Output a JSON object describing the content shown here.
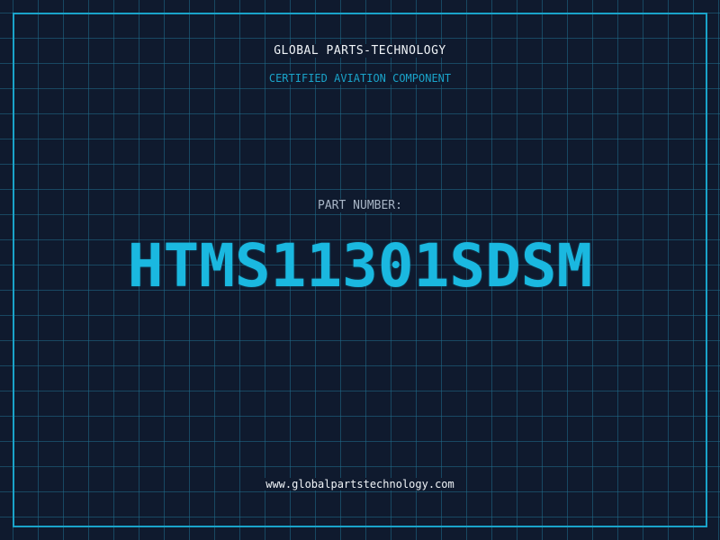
{
  "company_name": "GLOBAL PARTS-TECHNOLOGY",
  "tagline": "CERTIFIED AVIATION COMPONENT",
  "part_number_label": "PART NUMBER:",
  "part_number": "HTMS11301SDSM",
  "website": "www.globalpartstechnology.com",
  "colors": {
    "background": "#0f1a2e",
    "accent": "#1aa3c9",
    "part_number": "#1ab8e0",
    "text": "#f0f4f8",
    "label": "#a8b5c6"
  }
}
